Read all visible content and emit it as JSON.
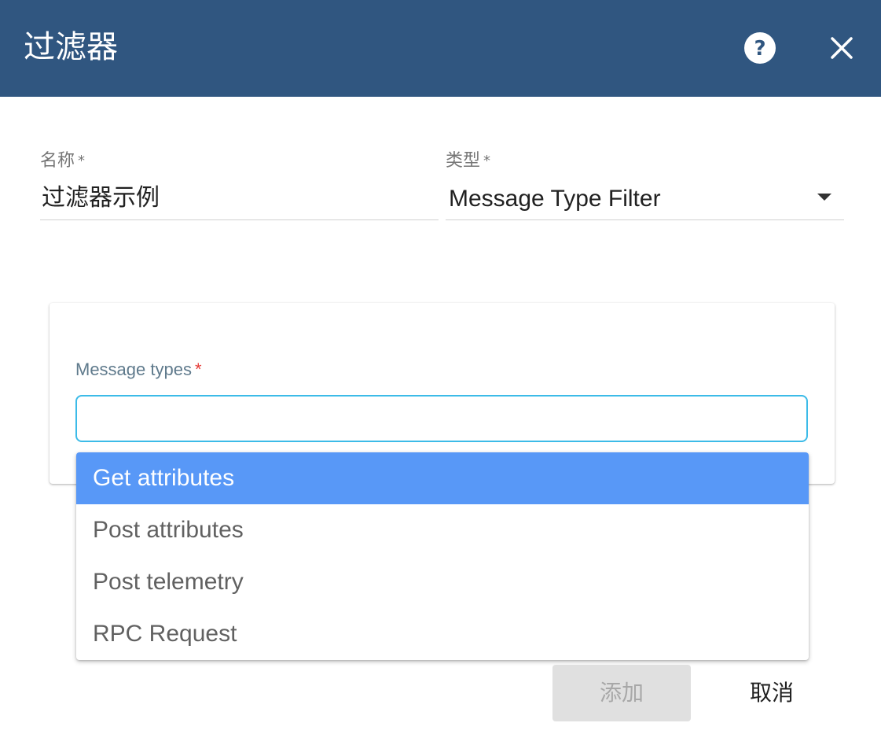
{
  "dialog": {
    "title": "过滤器",
    "help_icon": "help-circle-icon",
    "close_icon": "close-icon"
  },
  "form": {
    "name_label": "名称",
    "name_required": "*",
    "name_value": "过滤器示例",
    "type_label": "类型",
    "type_required": "*",
    "type_value": "Message Type Filter"
  },
  "message_types": {
    "label": "Message types",
    "required": "*",
    "input_value": "",
    "options": [
      {
        "label": "Get attributes",
        "highlighted": true
      },
      {
        "label": "Post attributes",
        "highlighted": false
      },
      {
        "label": "Post telemetry",
        "highlighted": false
      },
      {
        "label": "RPC Request",
        "highlighted": false
      }
    ]
  },
  "actions": {
    "add_label": "添加",
    "add_disabled": true,
    "cancel_label": "取消"
  },
  "colors": {
    "header_bg": "#305680",
    "highlight_bg": "#5898f7",
    "input_focus_border": "#3cbbe8",
    "required_star": "#e53935"
  }
}
